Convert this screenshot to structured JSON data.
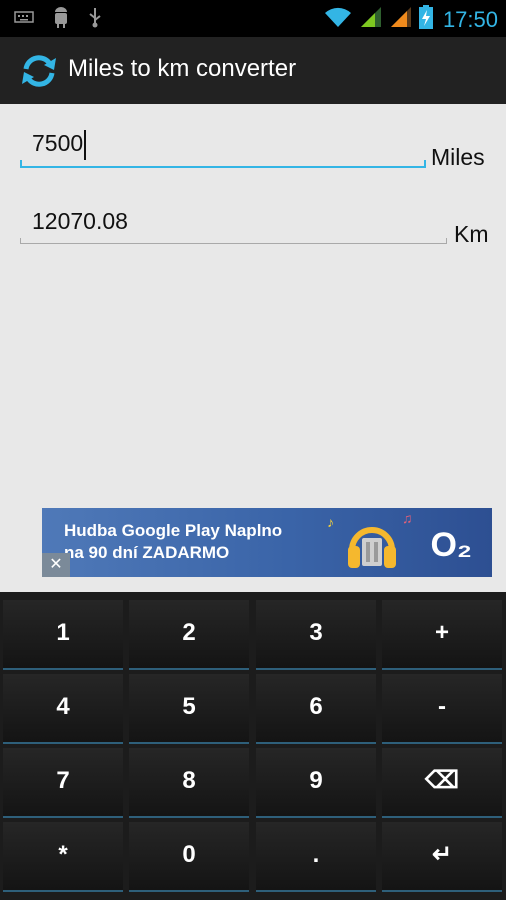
{
  "status_bar": {
    "time": "17:50",
    "icons": [
      "keyboard-icon",
      "android-debug-icon",
      "usb-icon",
      "wifi-icon",
      "signal-icon",
      "signal-roaming-icon",
      "battery-charging-icon"
    ]
  },
  "action_bar": {
    "title": "Miles to km converter",
    "icon": "refresh-icon"
  },
  "converter": {
    "miles_value": "7500",
    "miles_unit": "Miles",
    "km_value": "12070.08",
    "km_unit": "Km"
  },
  "ad": {
    "line1": "Hudba Google Play Naplno",
    "line2": "na 90 dní ZADARMO",
    "brand": "O₂",
    "close_label": "✕"
  },
  "keyboard": {
    "rows": [
      [
        "1",
        "2",
        "3",
        "+"
      ],
      [
        "4",
        "5",
        "6",
        "-"
      ],
      [
        "7",
        "8",
        "9",
        "⌫"
      ],
      [
        "*",
        "0",
        ".",
        "↵"
      ]
    ]
  },
  "colors": {
    "accent": "#33b5e5",
    "action_bar": "#222222",
    "keyboard_bg": "#1c1c1c",
    "content_bg": "#e8e8e8"
  }
}
